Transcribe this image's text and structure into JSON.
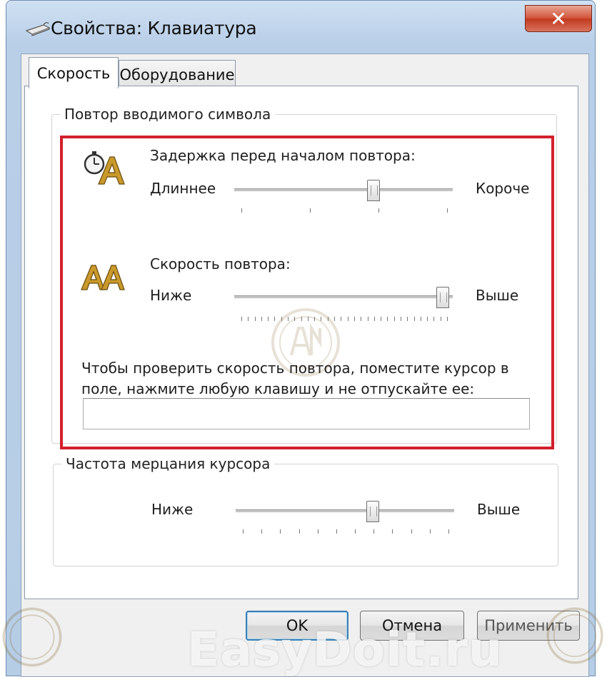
{
  "window": {
    "title": "Свойства: Клавиатура",
    "close_glyph": "✕"
  },
  "tabs": [
    {
      "label": "Скорость",
      "active": true
    },
    {
      "label": "Оборудование",
      "active": false
    }
  ],
  "repeat_group": {
    "title": "Повтор вводимого символа",
    "delay": {
      "label": "Задержка перед началом повтора:",
      "min_label": "Длиннее",
      "max_label": "Короче",
      "tick_count": 4,
      "value_fraction": 0.65
    },
    "rate": {
      "label": "Скорость повтора:",
      "min_label": "Ниже",
      "max_label": "Выше",
      "tick_count": 32,
      "value_fraction": 1.0
    },
    "test_text": "Чтобы проверить скорость повтора, поместите курсор в поле, нажмите любую клавишу и не отпускайте ее:",
    "test_input_value": ""
  },
  "blink_group": {
    "title": "Частота мерцания курсора",
    "min_label": "Ниже",
    "max_label": "Выше",
    "tick_count": 12,
    "value_fraction": 0.64
  },
  "buttons": {
    "ok": "OK",
    "cancel": "Отмена",
    "apply": "Применить"
  },
  "watermark": "EasyDoit.ru",
  "icons": {
    "window_icon": "keyboard-icon",
    "delay_icon": "stopwatch-letter-a-icon",
    "rate_icon": "double-letter-a-icon"
  },
  "colors": {
    "highlight": "#d2202b",
    "title_bar": "#b9cfe8",
    "close_button": "#c23a20"
  }
}
